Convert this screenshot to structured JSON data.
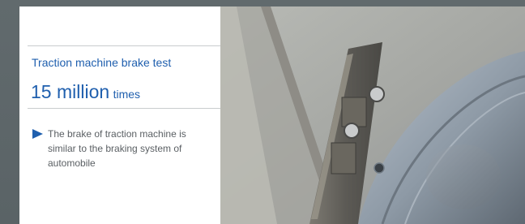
{
  "info_panel": {
    "heading": "Traction machine brake test",
    "headline_number": "15 million",
    "headline_unit": "times",
    "description": "The brake of traction machine is similar to the braking system of automobile",
    "bullet_icon": "triangle-arrow-right-icon",
    "accent_color": "#1f5fae"
  },
  "photo": {
    "subject": "traction-machine-brake-photo"
  }
}
